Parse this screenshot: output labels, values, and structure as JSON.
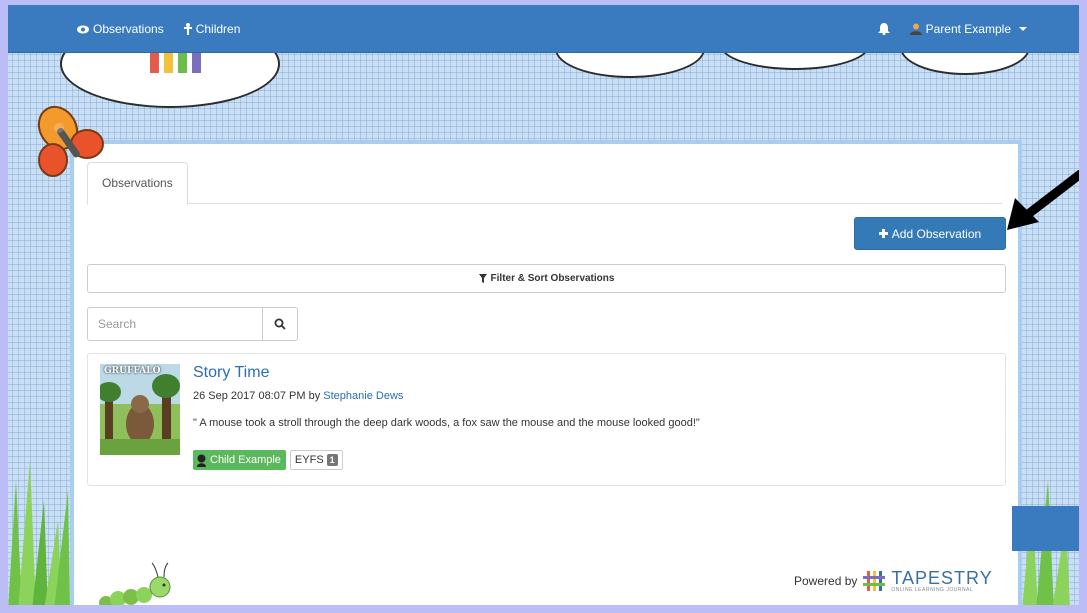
{
  "navbar": {
    "observations_label": "Observations",
    "children_label": "Children",
    "user_label": "Parent Example"
  },
  "tabs": [
    {
      "label": "Observations",
      "active": true
    }
  ],
  "toolbar": {
    "add_observation_label": "Add Observation",
    "filter_label": "Filter & Sort Observations"
  },
  "search": {
    "placeholder": "Search",
    "value": ""
  },
  "observations": [
    {
      "title": "Story Time",
      "date": "26 Sep 2017 08:07 PM",
      "by_label": "by",
      "author": "Stephanie Dews",
      "text": "\" A mouse took a stroll through the deep dark woods, a fox saw the mouse and the mouse looked good!\"",
      "child_tag": "Child Example",
      "framework_tag": "EYFS",
      "framework_count": "1",
      "thumbnail_text": "GRUFFALO"
    }
  ],
  "footer": {
    "powered_by": "Powered by",
    "brand": "TAPESTRY",
    "brand_sub": "ONLINE LEARNING JOURNAL"
  },
  "colors": {
    "navbar": "#3a7bbf",
    "primary_button": "#337ab7",
    "link": "#2a6eb5",
    "success_tag": "#5cb85c",
    "background": "#c9dff5",
    "frame": "#bcbcf6"
  },
  "icons": {
    "observations": "eye-icon",
    "children": "child-icon",
    "notifications": "bell-icon",
    "user": "user-icon",
    "add": "plus-icon",
    "filter": "filter-icon",
    "search": "search-icon"
  }
}
